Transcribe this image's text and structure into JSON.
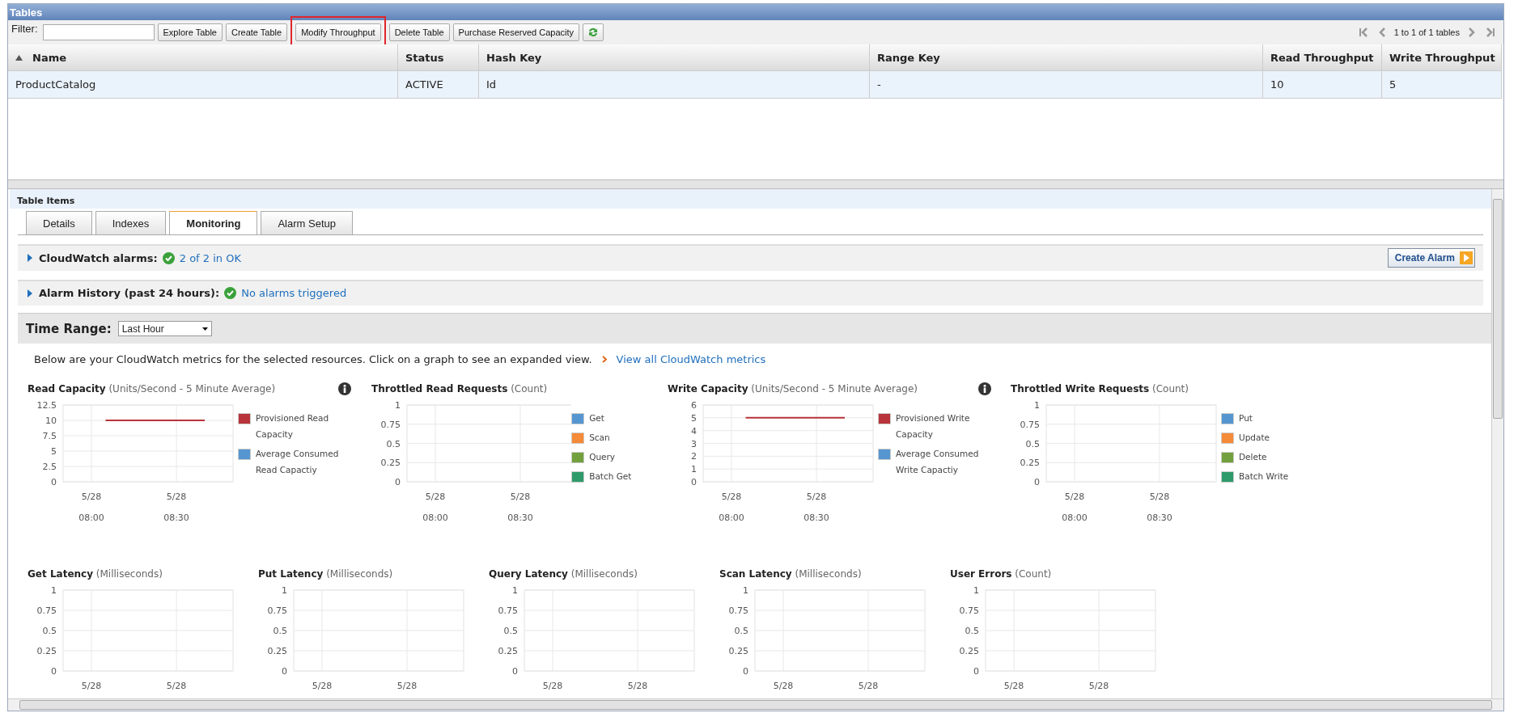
{
  "window": {
    "title": "Tables"
  },
  "toolbar": {
    "filter_label": "Filter:",
    "buttons": [
      {
        "kind": "text",
        "label": "Explore Table"
      },
      {
        "kind": "text",
        "label": "Create Table"
      },
      {
        "kind": "text",
        "label": "Modify Throughput",
        "highlighted": true
      },
      {
        "kind": "text",
        "label": "Delete Table"
      },
      {
        "kind": "text",
        "label": "Purchase Reserved Capacity"
      },
      {
        "kind": "refresh"
      }
    ],
    "pager": "1 to 1 of 1 tables"
  },
  "table": {
    "columns": [
      {
        "label": "Name",
        "sorted": true
      },
      {
        "label": "Status",
        "sorted": false
      },
      {
        "label": "Hash Key",
        "sorted": false
      },
      {
        "label": "Range Key",
        "sorted": false
      },
      {
        "label": "Read Throughput",
        "sorted": false
      },
      {
        "label": "Write Throughput",
        "sorted": false
      }
    ],
    "rows": [
      {
        "selected": true,
        "cells": [
          "ProductCatalog",
          "ACTIVE",
          "Id",
          "-",
          "10",
          "5"
        ]
      }
    ]
  },
  "details": {
    "title": "Table Items",
    "tabs": [
      {
        "label": "Details",
        "selected": false
      },
      {
        "label": "Indexes",
        "selected": false
      },
      {
        "label": "Monitoring",
        "selected": true
      },
      {
        "label": "Alarm Setup",
        "selected": false
      }
    ],
    "sections": [
      {
        "label": "CloudWatch alarms:",
        "expanded": false,
        "status": "2 of 2 in OK",
        "action": "Create Alarm"
      },
      {
        "label": "Alarm History (past 24 hours):",
        "expanded": false,
        "status": "No alarms triggered"
      }
    ],
    "time_range": {
      "label": "Time Range:",
      "value": "Last Hour"
    },
    "intro": "Below are your CloudWatch metrics for the selected resources. Click on a graph to see an expanded view.",
    "metrics_link": "View all CloudWatch metrics",
    "charts": [
      {
        "info": true,
        "chart_data": {
          "type": "line",
          "title": "**Read Capacity** (Units/Second - 5 Minute Average)",
          "grid": true,
          "categories": [
            "5/28\n08:00",
            null,
            null,
            null,
            null,
            null,
            "5/28\n08:30",
            null,
            null
          ],
          "ylim": [
            0,
            12.5
          ],
          "yticks": [
            0,
            2.5,
            5,
            7.5,
            10,
            12.5
          ],
          "series": [
            {
              "name": "Provisioned Read Capacity",
              "color": "#b8333a",
              "values": [
                null,
                10,
                10,
                10,
                10,
                10,
                10,
                10,
                10
              ]
            },
            {
              "name": "Average Consumed Read Capactiy",
              "color": "#5596d0",
              "values": [
                null,
                null,
                null,
                null,
                null,
                null,
                null,
                null,
                null
              ]
            }
          ]
        }
      },
      {
        "chart_data": {
          "type": "line",
          "title": "**Throttled Read Requests** (Count)",
          "grid": true,
          "categories": [
            "5/28\n08:00",
            null,
            null,
            null,
            null,
            null,
            "5/28\n08:30",
            null,
            null
          ],
          "ylim": [
            0,
            1
          ],
          "yticks": [
            0,
            0.25,
            0.5,
            0.75,
            1
          ],
          "series": [
            {
              "name": "Get",
              "color": "#5596d0",
              "values": [
                null,
                null,
                null,
                null,
                null,
                null,
                null,
                null,
                null
              ]
            },
            {
              "name": "Scan",
              "color": "#f58a38",
              "values": [
                null,
                null,
                null,
                null,
                null,
                null,
                null,
                null,
                null
              ]
            },
            {
              "name": "Query",
              "color": "#72a03e",
              "values": [
                null,
                null,
                null,
                null,
                null,
                null,
                null,
                null,
                null
              ]
            },
            {
              "name": "Batch Get",
              "color": "#2f9a6a",
              "values": [
                null,
                null,
                null,
                null,
                null,
                null,
                null,
                null,
                null
              ]
            }
          ]
        }
      },
      {
        "info": true,
        "chart_data": {
          "type": "line",
          "title": "**Write Capacity** (Units/Second - 5 Minute Average)",
          "grid": true,
          "categories": [
            "5/28\n08:00",
            null,
            null,
            null,
            null,
            null,
            "5/28\n08:30",
            null,
            null
          ],
          "ylim": [
            0,
            6
          ],
          "yticks": [
            0,
            1,
            2,
            3,
            4,
            5,
            6
          ],
          "series": [
            {
              "name": "Provisioned Write Capacity",
              "color": "#b8333a",
              "values": [
                null,
                5,
                5,
                5,
                5,
                5,
                5,
                5,
                5
              ]
            },
            {
              "name": "Average Consumed Write Capactiy",
              "color": "#5596d0",
              "values": [
                null,
                null,
                null,
                null,
                null,
                null,
                null,
                null,
                null
              ]
            }
          ]
        }
      },
      {
        "chart_data": {
          "type": "line",
          "title": "**Throttled Write Requests** (Count)",
          "grid": true,
          "categories": [
            "5/28\n08:00",
            null,
            null,
            null,
            null,
            null,
            "5/28\n08:30",
            null,
            null
          ],
          "ylim": [
            0,
            1
          ],
          "yticks": [
            0,
            0.25,
            0.5,
            0.75,
            1
          ],
          "series": [
            {
              "name": "Put",
              "color": "#5596d0",
              "values": [
                null,
                null,
                null,
                null,
                null,
                null,
                null,
                null,
                null
              ]
            },
            {
              "name": "Update",
              "color": "#f58a38",
              "values": [
                null,
                null,
                null,
                null,
                null,
                null,
                null,
                null,
                null
              ]
            },
            {
              "name": "Delete",
              "color": "#72a03e",
              "values": [
                null,
                null,
                null,
                null,
                null,
                null,
                null,
                null,
                null
              ]
            },
            {
              "name": "Batch Write",
              "color": "#2f9a6a",
              "values": [
                null,
                null,
                null,
                null,
                null,
                null,
                null,
                null,
                null
              ]
            }
          ]
        }
      }
    ],
    "small_charts": [
      {
        "chart_data": {
          "type": "line",
          "title": "**Get Latency** (Milliseconds)",
          "grid": true,
          "categories": [
            "5/28",
            null,
            null,
            null,
            null,
            null,
            "5/28",
            null,
            null
          ],
          "ylim": [
            0,
            1
          ],
          "yticks": [
            0,
            0.25,
            0.5,
            0.75,
            1
          ]
        }
      },
      {
        "chart_data": {
          "type": "line",
          "title": "**Put Latency** (Milliseconds)",
          "grid": true,
          "categories": [
            "5/28",
            null,
            null,
            null,
            null,
            null,
            "5/28",
            null,
            null
          ],
          "ylim": [
            0,
            1
          ],
          "yticks": [
            0,
            0.25,
            0.5,
            0.75,
            1
          ]
        }
      },
      {
        "chart_data": {
          "type": "line",
          "title": "**Query Latency** (Milliseconds)",
          "grid": true,
          "categories": [
            "5/28",
            null,
            null,
            null,
            null,
            null,
            "5/28",
            null,
            null
          ],
          "ylim": [
            0,
            1
          ],
          "yticks": [
            0,
            0.25,
            0.5,
            0.75,
            1
          ]
        }
      },
      {
        "chart_data": {
          "type": "line",
          "title": "**Scan Latency** (Milliseconds)",
          "grid": true,
          "categories": [
            "5/28",
            null,
            null,
            null,
            null,
            null,
            "5/28",
            null,
            null
          ],
          "ylim": [
            0,
            1
          ],
          "yticks": [
            0,
            0.25,
            0.5,
            0.75,
            1
          ]
        }
      },
      {
        "chart_data": {
          "type": "line",
          "title": "**User Errors** (Count)",
          "grid": true,
          "categories": [
            "5/28",
            null,
            null,
            null,
            null,
            null,
            "5/28",
            null,
            null
          ],
          "ylim": [
            0,
            1
          ],
          "yticks": [
            0,
            0.25,
            0.5,
            0.75,
            1
          ]
        }
      }
    ]
  }
}
